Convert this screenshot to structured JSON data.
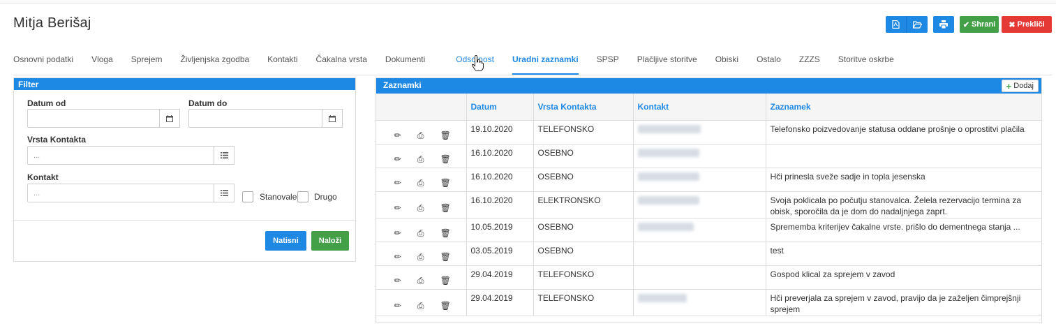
{
  "page": {
    "title": "Mitja Berišaj"
  },
  "toolbar": {
    "pdf_icon": "file-pdf-icon",
    "folder_icon": "folder-open-icon",
    "print_icon": "print-icon",
    "save_label": "Shrani",
    "cancel_label": "Prekliči",
    "colors": {
      "primary": "#1e88e5",
      "success": "#43a047",
      "danger": "#e53935"
    }
  },
  "tabs": [
    {
      "label": "Osnovni podatki"
    },
    {
      "label": "Vloga"
    },
    {
      "label": "Sprejem"
    },
    {
      "label": "Življenjska zgodba"
    },
    {
      "label": "Kontakti"
    },
    {
      "label": "Čakalna vrsta"
    },
    {
      "label": "Dokumenti"
    },
    {
      "label": "Odsotnost"
    },
    {
      "label": "Uradni zaznamki",
      "active": true
    },
    {
      "label": "SPSP"
    },
    {
      "label": "Plačljive storitve"
    },
    {
      "label": "Obiski"
    },
    {
      "label": "Ostalo"
    },
    {
      "label": "ZZZS"
    },
    {
      "label": "Storitve oskrbe"
    }
  ],
  "filter": {
    "title": "Filter",
    "date_from_label": "Datum od",
    "date_to_label": "Datum do",
    "contact_type_label": "Vrsta Kontakta",
    "contact_type_placeholder": "...",
    "contact_label": "Kontakt",
    "contact_placeholder": "...",
    "checkbox_resident": "Stanovalec",
    "checkbox_other": "Drugo",
    "print_button": "Natisni",
    "load_button": "Naloži"
  },
  "notes": {
    "title": "Zaznamki",
    "add_button": "Dodaj",
    "columns": [
      "Datum",
      "Vrsta Kontakta",
      "Kontakt",
      "Zaznamek"
    ],
    "rows": [
      {
        "date": "19.10.2020",
        "type": "TELEFONSKO",
        "contact_blurred": true,
        "note": "Telefonsko poizvedovanje statusa oddane prošnje o oprostitvi plačila"
      },
      {
        "date": "16.10.2020",
        "type": "OSEBNO",
        "contact_blurred": true,
        "note": ""
      },
      {
        "date": "16.10.2020",
        "type": "OSEBNO",
        "contact_blurred": true,
        "note": "Hči prinesla sveže sadje in topla jesenska"
      },
      {
        "date": "16.10.2020",
        "type": "ELEKTRONSKO",
        "contact_blurred": true,
        "note": "Svoja poklicala po počutju stanovalca. Želela rezervacijo termina za obisk, sporočila da je dom do nadaljnjega zaprt."
      },
      {
        "date": "10.05.2019",
        "type": "OSEBNO",
        "contact_blurred": true,
        "note": "Sprememba kriterijev čakalne vrste. prišlo do dementnega stanja ..."
      },
      {
        "date": "03.05.2019",
        "type": "OSEBNO",
        "contact_blurred": false,
        "note": "test"
      },
      {
        "date": "29.04.2019",
        "type": "TELEFONSKO",
        "contact_blurred": false,
        "note": "Gospod klical za sprejem v zavod"
      },
      {
        "date": "29.04.2019",
        "type": "TELEFONSKO",
        "contact_blurred": true,
        "note": "Hči preverjala za sprejem v zavod, pravijo da je zažel​jen čimprejšnji sprejem"
      }
    ]
  }
}
